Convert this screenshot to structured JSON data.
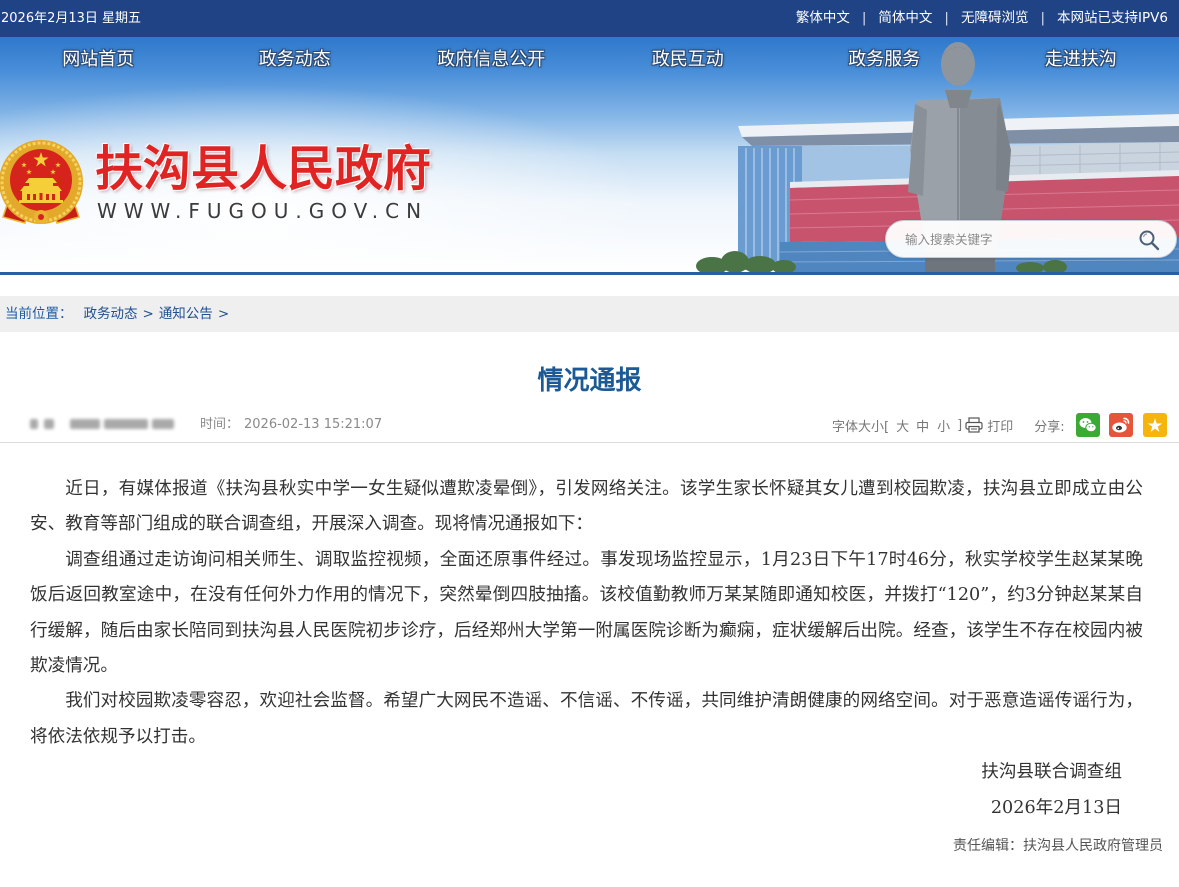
{
  "topbar": {
    "date": "2026年2月13日 星期五",
    "links": [
      "繁体中文",
      "简体中文",
      "无障碍浏览",
      "本网站已支持IPV6"
    ],
    "separator": "|"
  },
  "nav": [
    {
      "label": "网站首页"
    },
    {
      "label": "政务动态"
    },
    {
      "label": "政府信息公开"
    },
    {
      "label": "政民互动"
    },
    {
      "label": "政务服务"
    },
    {
      "label": "走进扶沟"
    }
  ],
  "site": {
    "title": "扶沟县人民政府",
    "url": "WWW.FUGOU.GOV.CN",
    "emblem_icon": "national-emblem-icon"
  },
  "search": {
    "placeholder": "输入搜索关键字",
    "icon": "search-icon"
  },
  "breadcrumb": {
    "prefix": "当前位置：",
    "items": [
      "政务动态",
      "通知公告"
    ],
    "separator": ">"
  },
  "article": {
    "title": "情况通报",
    "time_label": "时间：",
    "time": "2026-02-13 15:21:07",
    "font_size_label": "字体大小[",
    "font_sizes": [
      "大",
      "中",
      "小"
    ],
    "font_size_close": "]",
    "print_icon": "printer-icon",
    "print_label": "打印",
    "share_label": "分享:",
    "share_icons": [
      "wechat-icon",
      "weibo-icon",
      "favorite-star-icon"
    ],
    "paragraphs": [
      "近日，有媒体报道《扶沟县秋实中学一女生疑似遭欺凌晕倒》，引发网络关注。该学生家长怀疑其女儿遭到校园欺凌，扶沟县立即成立由公安、教育等部门组成的联合调查组，开展深入调查。现将情况通报如下：",
      "调查组通过走访询问相关师生、调取监控视频，全面还原事件经过。事发现场监控显示，1月23日下午17时46分，秋实学校学生赵某某晚饭后返回教室途中，在没有任何外力作用的情况下，突然晕倒四肢抽搐。该校值勤教师万某某随即通知校医，并拨打“120”，约3分钟赵某某自行缓解，随后由家长陪同到扶沟县人民医院初步诊疗，后经郑州大学第一附属医院诊断为癫痫，症状缓解后出院。经查，该学生不存在校园内被欺凌情况。",
      "我们对校园欺凌零容忍，欢迎社会监督。希望广大网民不造谣、不信谣、不传谣，共同维护清朗健康的网络空间。对于恶意造谣传谣行为，将依法依规予以打击。"
    ],
    "signature_org": "扶沟县联合调查组",
    "signature_date": "2026年2月13日",
    "editor": "责任编辑：扶沟县人民政府管理员"
  },
  "colors": {
    "topbar_bg": "#1f4384",
    "site_title": "#e02424",
    "article_title": "#1b5a96",
    "body_text": "#333333",
    "breadcrumb_bg": "#efefef",
    "breadcrumb_link": "#22508f",
    "banner_line": "#2c5ea6",
    "wechat": "#3aaa35",
    "weibo": "#e6553a",
    "favorite": "#f5b50d"
  }
}
